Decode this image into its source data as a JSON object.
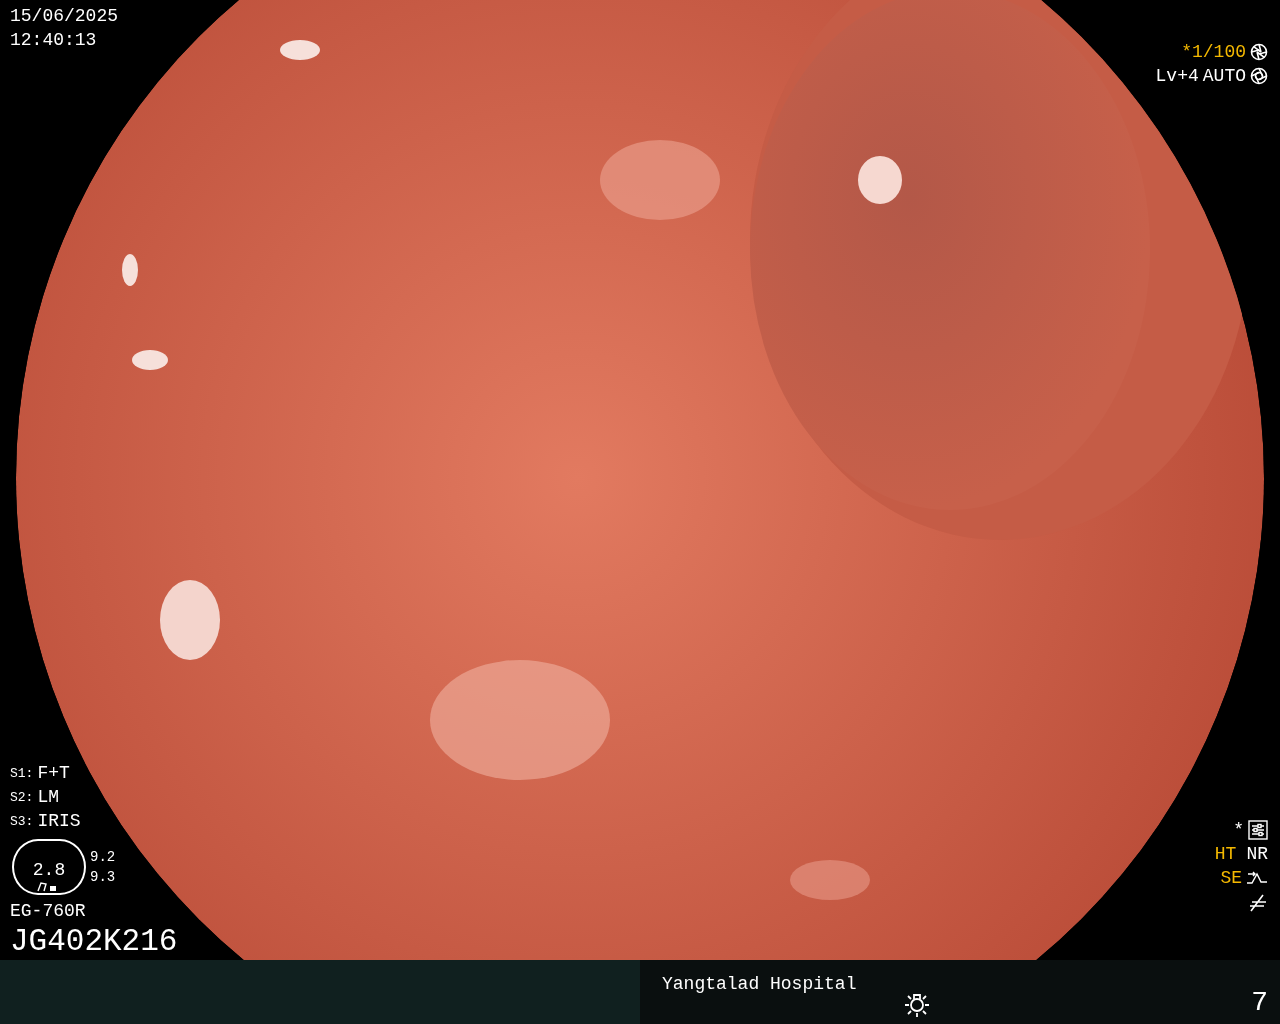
{
  "timestamp": {
    "date": "15/06/2025",
    "time": "12:40:13"
  },
  "exposure": {
    "shutter": {
      "text": "*1/100",
      "on": true
    },
    "level": "Lv+4",
    "mode": "AUTO"
  },
  "switches": [
    {
      "key": "S1:",
      "value": "F+T"
    },
    {
      "key": "S2:",
      "value": "LM"
    },
    {
      "key": "S3:",
      "value": "IRIS"
    }
  ],
  "zoom_display": {
    "value": "2.8",
    "readings": [
      "9.2",
      "9.3"
    ]
  },
  "scope": {
    "model": "EG-760R",
    "serial": "JG402K216"
  },
  "enhancements": {
    "marker": "*",
    "row_1": [
      {
        "text": "HT",
        "on": true
      },
      {
        "text": "NR",
        "on": false
      }
    ],
    "row_2": [
      {
        "text": "SE",
        "on": true
      }
    ]
  },
  "footer": {
    "hospital": "Yangtalad Hospital",
    "number": "7"
  }
}
